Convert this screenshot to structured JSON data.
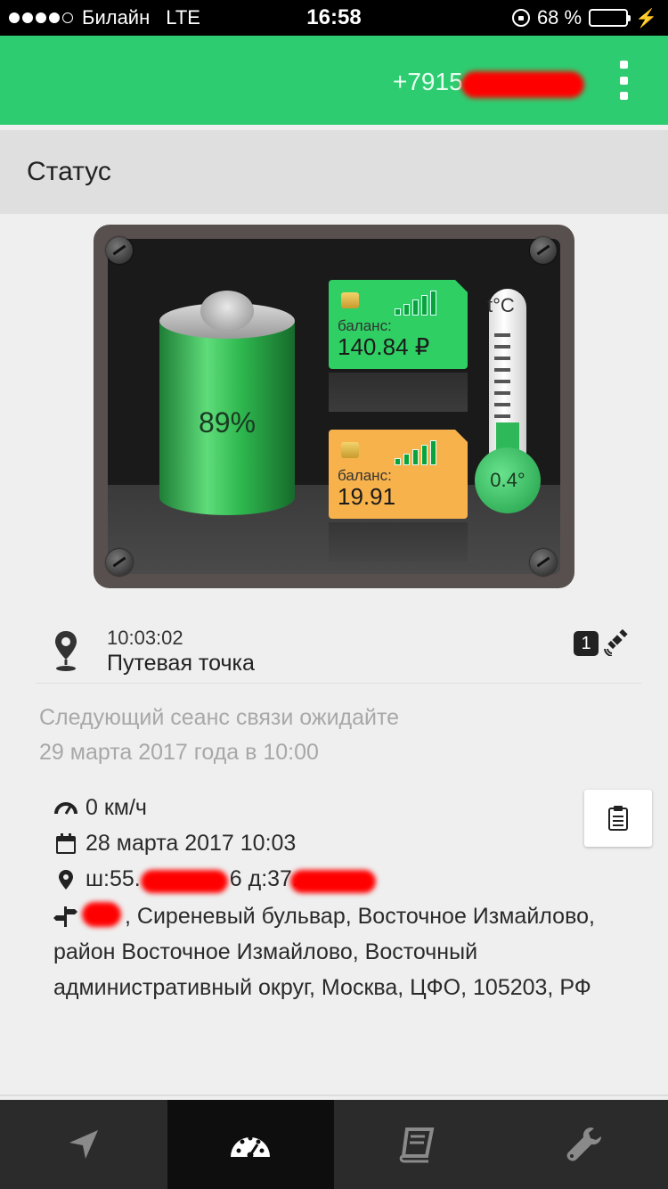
{
  "status_bar": {
    "carrier": "Билайн",
    "network": "LTE",
    "time": "16:58",
    "battery_percent": "68 %",
    "battery_level": 0.68,
    "signal_dots_filled": 4
  },
  "app_bar": {
    "phone_prefix": "+7915",
    "menu_icon": "kebab-menu-icon",
    "color": "#2ecc71"
  },
  "section": {
    "title": "Статус"
  },
  "device": {
    "battery_percent": "89%",
    "battery_level": 0.89,
    "sim1": {
      "label": "баланс:",
      "value": "140.84 ₽",
      "color": "#2fcf63"
    },
    "sim2": {
      "label": "баланс:",
      "value": "19.91",
      "color": "#f8b24c"
    },
    "thermometer": {
      "unit_label": "t°C",
      "value": "0.4°"
    }
  },
  "waypoint": {
    "time": "10:03:02",
    "label": "Путевая точка",
    "satellite_count": "1",
    "pin_icon": "map-pin-icon",
    "satellite_icon": "satellite-icon"
  },
  "next_session": {
    "line1": "Следующий сеанс связи ожидайте",
    "line2": "29 марта 2017 года в 10:00"
  },
  "details": {
    "speed": "0 км/ч",
    "datetime": "28 марта 2017 10:03",
    "coord_lat_prefix": "ш:55.",
    "coord_mid": "6 д:37.",
    "address_rest": ", Сиреневый бульвар, Восточное Измайлово, район Восточное Измайлово, Восточный административный округ, Москва, ЦФО, 105203, РФ"
  },
  "tabs": [
    {
      "name": "navigation",
      "icon": "navigation-arrow-icon"
    },
    {
      "name": "dashboard",
      "icon": "speedometer-icon",
      "active": true
    },
    {
      "name": "log",
      "icon": "book-icon"
    },
    {
      "name": "settings",
      "icon": "wrench-icon"
    }
  ]
}
